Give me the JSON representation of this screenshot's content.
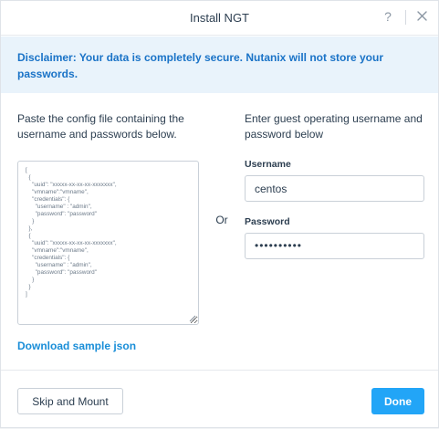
{
  "dialog": {
    "title": "Install NGT",
    "help_glyph": "?"
  },
  "disclaimer": {
    "text": "Disclaimer: Your data is completely secure. Nutanix will not store your passwords."
  },
  "config": {
    "instruction": "Paste the config file containing the username and passwords below.",
    "sample_text": "[\n  {\n    \"uuid\": \"xxxxx-xx-xx-xx-xxxxxxx\",\n    \"vmname\":\"vmname\",\n    \"credentials\": {\n      \"username\" : \"admin\",\n      \"password\": \"password\"\n    }\n  },\n  {\n    \"uuid\": \"xxxxx-xx-xx-xx-xxxxxxx\",\n    \"vmname\":\"vmname\",\n    \"credentials\": {\n      \"username\" : \"admin\",\n      \"password\": \"password\"\n    }\n  }\n]",
    "download_link": "Download sample json"
  },
  "divider": {
    "or_label": "Or"
  },
  "guest": {
    "instruction": "Enter guest operating username and password below",
    "username_label": "Username",
    "username_value": "centos",
    "password_label": "Password",
    "password_value": "••••••••••"
  },
  "footer": {
    "skip_label": "Skip and Mount",
    "done_label": "Done"
  },
  "colors": {
    "accent": "#22a5f7",
    "link": "#1a8ed8",
    "disclaimer_bg": "#e9f3fb",
    "disclaimer_text": "#1a73c7"
  },
  "icons": {
    "help": "help-icon",
    "close": "close-icon"
  }
}
